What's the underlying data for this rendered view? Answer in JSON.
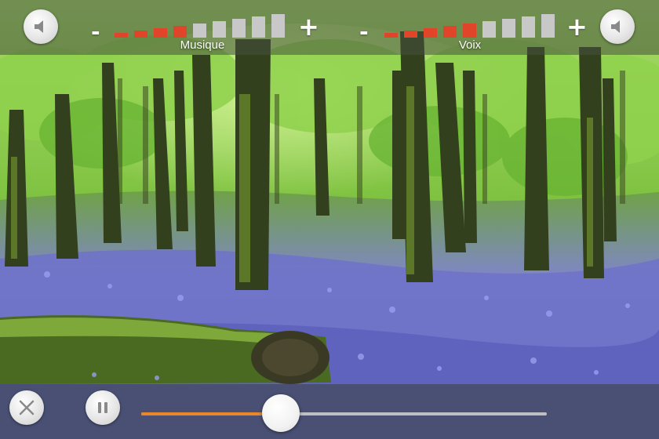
{
  "colors": {
    "volume_on": "#e0452a",
    "volume_off": "#c8c8c8",
    "progress_fill": "#e8862a",
    "track": "#bfbfbf"
  },
  "music_volume": {
    "label": "Musique",
    "minus": "-",
    "plus": "+",
    "level": 4,
    "steps": 9,
    "icon": "speaker-icon"
  },
  "voice_volume": {
    "label": "Voix",
    "minus": "-",
    "plus": "+",
    "level": 5,
    "steps": 9,
    "icon": "speaker-icon"
  },
  "playback": {
    "close_icon": "close-icon",
    "pause_icon": "pause-icon",
    "progress": 0.345
  }
}
